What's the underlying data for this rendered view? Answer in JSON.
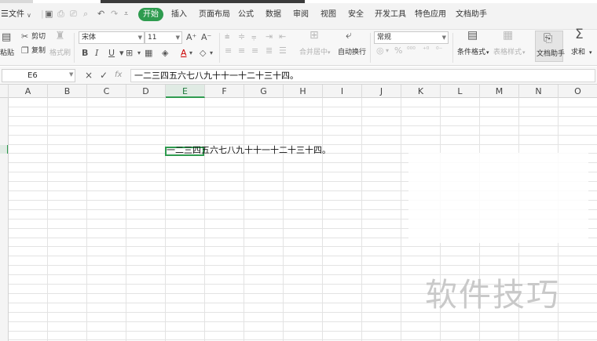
{
  "menu": {
    "file": "文件",
    "tabs": [
      "开始",
      "插入",
      "页面布局",
      "公式",
      "数据",
      "审阅",
      "视图",
      "安全",
      "开发工具",
      "特色应用",
      "文档助手"
    ]
  },
  "ribbon": {
    "paste": "粘贴",
    "cut": "剪切",
    "copy": "复制",
    "format_painter": "格式刷",
    "font_name": "宋体",
    "font_size": "11",
    "bold": "B",
    "italic": "I",
    "underline": "U",
    "font_color_letter": "A",
    "merge_center": "合并居中",
    "wrap_text": "自动换行",
    "number_format": "常规",
    "percent": "%",
    "conditional_format": "条件格式",
    "table_style": "表格样式",
    "doc_helper": "文档助手",
    "sum": "求和",
    "sum_symbol": "Σ"
  },
  "formula_bar": {
    "cell_ref": "E6",
    "cancel": "×",
    "confirm": "✓",
    "fx": "fx",
    "content": "一二三四五六七八九十十一十二十三十四。"
  },
  "sheet": {
    "columns": [
      "A",
      "B",
      "C",
      "D",
      "E",
      "F",
      "G",
      "H",
      "I",
      "J",
      "K",
      "L",
      "M",
      "N",
      "O"
    ],
    "active_column": "E",
    "active_row": "6",
    "cell_E6": "一二三四五六七八九十十一十二十三十四。"
  },
  "watermark": "软件技巧",
  "colors": {
    "accent": "#2e9b4f",
    "grid": "#e3e3e3"
  }
}
